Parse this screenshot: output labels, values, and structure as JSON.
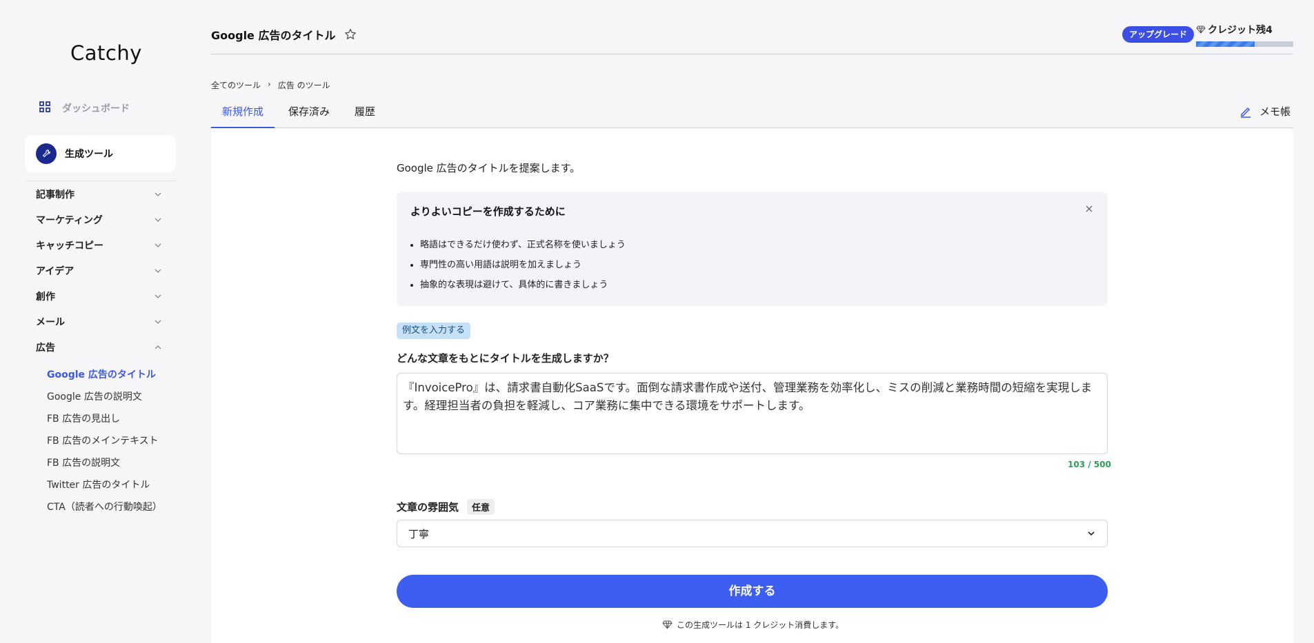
{
  "app": {
    "logo": "Catchy"
  },
  "sidebar": {
    "dashboard": "ダッシュボード",
    "generator": "生成ツール",
    "categories": [
      {
        "label": "記事制作",
        "open": false
      },
      {
        "label": "マーケティング",
        "open": false
      },
      {
        "label": "キャッチコピー",
        "open": false
      },
      {
        "label": "アイデア",
        "open": false
      },
      {
        "label": "創作",
        "open": false
      },
      {
        "label": "メール",
        "open": false
      },
      {
        "label": "広告",
        "open": true
      }
    ],
    "ad_items": [
      "Google 広告のタイトル",
      "Google 広告の説明文",
      "FB 広告の見出し",
      "FB 広告のメインテキスト",
      "FB 広告の説明文",
      "Twitter 広告のタイトル",
      "CTA（読者への行動喚起）"
    ],
    "active_item": "Google 広告のタイトル"
  },
  "header": {
    "title": "Google 広告のタイトル",
    "upgrade": "アップグレード",
    "credit": "クレジット残4",
    "credit_fraction": 0.6
  },
  "breadcrumb": {
    "root": "全てのツール",
    "sep": "›",
    "current": "広告 のツール"
  },
  "tabs": [
    "新規作成",
    "保存済み",
    "履歴"
  ],
  "memo": "メモ帳",
  "main": {
    "description": "Google 広告のタイトルを提案します。",
    "tips_title": "よりよいコピーを作成するために",
    "tips": [
      "略語はできるだけ使わず、正式名称を使いましょう",
      "専門性の高い用語は説明を加えましょう",
      "抽象的な表現は避けて、具体的に書きましょう"
    ],
    "example_button": "例文を入力する",
    "question": "どんな文章をもとにタイトルを生成しますか？",
    "input_text": "『InvoicePro』は、請求書自動化SaaSです。面倒な請求書作成や送付、管理業務を効率化し、ミスの削減と業務時間の短縮を実現します。経理担当者の負担を軽減し、コア業務に集中できる環境をサポートします。",
    "counter": "103 / 500",
    "mood_label": "文章の雰囲気",
    "optional": "任意",
    "mood_value": "丁寧",
    "submit": "作成する",
    "note": "この生成ツールは 1 クレジット消費します。"
  },
  "colors": {
    "accent": "#3e5ef2",
    "active_link": "#3b58e8",
    "counter": "#2e9e5b"
  }
}
